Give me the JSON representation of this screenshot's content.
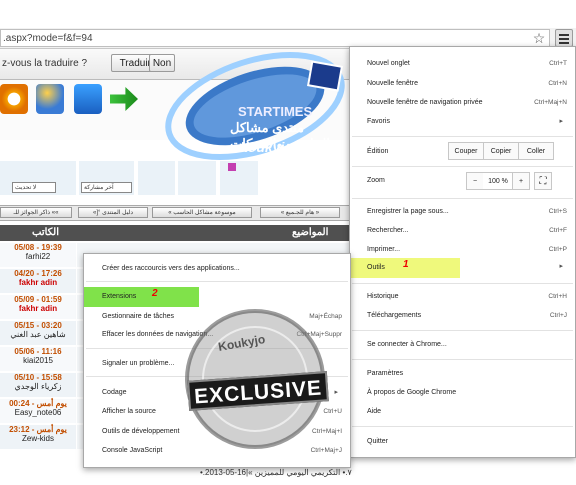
{
  "browser": {
    "url": ".aspx?mode=f&f=94"
  },
  "translate_bar": {
    "prompt": "z-vous la traduire ?",
    "translate_label": "Traduire",
    "no_label": "Non"
  },
  "forum": {
    "logo_brand": "STARTIMES",
    "logo_title": "منتدى مشاكل الحاسب والشبكات",
    "logo_signature": "koukyjo",
    "nav_items": [
      "ذاكر الجوائز للـ ««",
      "«]° دليل المنتدى",
      "« موسوعة مشاكل الحاسب",
      "« هام للجـميع »"
    ],
    "col_author": "الكاتب",
    "col_topics": "المواضيع",
    "sort_select": "لا تحديث",
    "order_select": "آخر مشاركة",
    "rows": [
      {
        "date": "05/08 - 19:39",
        "user": "farhi22",
        "red": false
      },
      {
        "date": "04/20 - 17:26",
        "user": "fakhr adin",
        "red": true
      },
      {
        "date": "05/09 - 01:59",
        "user": "fakhr adin",
        "red": true
      },
      {
        "date": "05/15 - 03:20",
        "user": "شاهين عبد الغني",
        "red": false
      },
      {
        "date": "05/06 - 11:16",
        "user": "kiai2015",
        "red": false
      },
      {
        "date": "05/10 - 15:58",
        "user": "زكرياء الوجدي",
        "red": false
      },
      {
        "date": "يوم أمس - 00:24",
        "user": "Easy_note06",
        "red": false
      },
      {
        "date": "يوم أمس - 23:12",
        "user": "Zew-kids",
        "red": false
      }
    ],
    "last_topic": "•.٧.• التكريمي اليومي للمميزين »|16-05-2013"
  },
  "chrome_menu": {
    "items": [
      {
        "label": "Nouvel onglet",
        "shortcut": "Ctrl+T"
      },
      {
        "label": "Nouvelle fenêtre",
        "shortcut": "Ctrl+N"
      },
      {
        "label": "Nouvelle fenêtre de navigation privée",
        "shortcut": "Ctrl+Maj+N"
      },
      {
        "label": "Favoris",
        "shortcut": ""
      },
      {
        "label": "Édition",
        "shortcut": ""
      },
      {
        "label": "Zoom",
        "shortcut": ""
      },
      {
        "label": "Enregistrer la page sous...",
        "shortcut": "Ctrl+S"
      },
      {
        "label": "Rechercher...",
        "shortcut": "Ctrl+F"
      },
      {
        "label": "Imprimer...",
        "shortcut": "Ctrl+P"
      },
      {
        "label": "Outils",
        "shortcut": ""
      },
      {
        "label": "Historique",
        "shortcut": "Ctrl+H"
      },
      {
        "label": "Téléchargements",
        "shortcut": "Ctrl+J"
      },
      {
        "label": "Se connecter à Chrome...",
        "shortcut": ""
      },
      {
        "label": "Paramètres",
        "shortcut": ""
      },
      {
        "label": "À propos de Google Chrome",
        "shortcut": ""
      },
      {
        "label": "Aide",
        "shortcut": ""
      },
      {
        "label": "Quitter",
        "shortcut": ""
      }
    ],
    "cut": "Couper",
    "copy": "Copier",
    "paste": "Coller",
    "zoom_level": "100 %",
    "zoom_minus": "−",
    "zoom_plus": "+",
    "step_one": "1"
  },
  "tools_submenu": {
    "items": [
      {
        "label": "Créer des raccourcis vers des applications...",
        "shortcut": ""
      },
      {
        "label": "Extensions",
        "shortcut": ""
      },
      {
        "label": "Gestionnaire de tâches",
        "shortcut": "Maj+Échap"
      },
      {
        "label": "Effacer les données de navigation...",
        "shortcut": "Ctrl+Maj+Suppr"
      },
      {
        "label": "Signaler un problème...",
        "shortcut": ""
      },
      {
        "label": "Codage",
        "shortcut": ""
      },
      {
        "label": "Afficher la source",
        "shortcut": "Ctrl+U"
      },
      {
        "label": "Outils de développement",
        "shortcut": "Ctrl+Maj+I"
      },
      {
        "label": "Console JavaScript",
        "shortcut": "Ctrl+Maj+J"
      }
    ],
    "step_two": "2"
  },
  "watermark": {
    "text": "EXCLUSIVE",
    "arc_text": "Koukyjo"
  }
}
